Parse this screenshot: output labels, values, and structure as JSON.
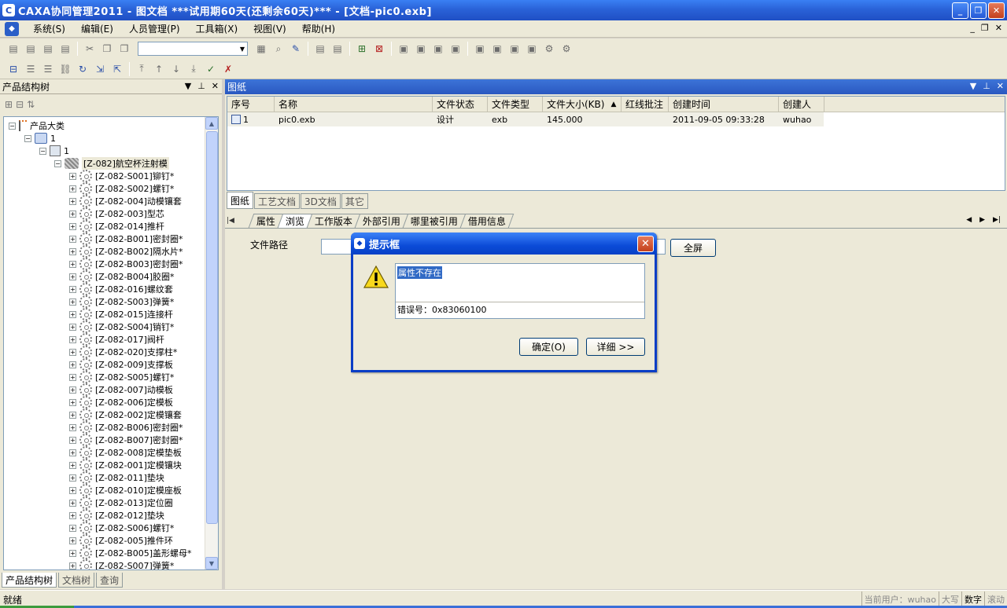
{
  "window": {
    "app_icon": "C",
    "title": "CAXA协同管理2011 - 图文档   ***试用期60天(还剩余60天)*** - [文档-pic0.exb]",
    "buttons": {
      "minimize": "_",
      "restore": "❐",
      "close": "✕"
    }
  },
  "menu": {
    "items": [
      "系统(S)",
      "编辑(E)",
      "人员管理(P)",
      "工具箱(X)",
      "视图(V)",
      "帮助(H)"
    ],
    "mdi_buttons": {
      "minimize": "_",
      "restore": "❐",
      "close": "✕"
    }
  },
  "left_panel": {
    "title": "产品结构树",
    "header_buttons": {
      "dropdown": "▼",
      "pin": "⊥",
      "close": "✕"
    },
    "tree": {
      "root": "产品大类",
      "level1": "1",
      "level2": "1",
      "assembly": "[Z-082]航空杯注射模",
      "parts": [
        "[Z-082-S001]铆钉*",
        "[Z-082-S002]螺钉*",
        "[Z-082-004]动模镶套",
        "[Z-082-003]型芯",
        "[Z-082-014]推杆",
        "[Z-082-B001]密封圈*",
        "[Z-082-B002]隔水片*",
        "[Z-082-B003]密封圈*",
        "[Z-082-B004]胶圈*",
        "[Z-082-016]螺纹套",
        "[Z-082-S003]弹簧*",
        "[Z-082-015]连接杆",
        "[Z-082-S004]销钉*",
        "[Z-082-017]阀杆",
        "[Z-082-020]支撑柱*",
        "[Z-082-009]支撑板",
        "[Z-082-S005]螺钉*",
        "[Z-082-007]动模板",
        "[Z-082-006]定模板",
        "[Z-082-002]定模镶套",
        "[Z-082-B006]密封圈*",
        "[Z-082-B007]密封圈*",
        "[Z-082-008]定模垫板",
        "[Z-082-001]定模镶块",
        "[Z-082-011]垫块",
        "[Z-082-010]定模座板",
        "[Z-082-013]定位圈",
        "[Z-082-012]垫块",
        "[Z-082-S006]螺钉*",
        "[Z-082-005]推件环",
        "[Z-082-B005]盖形螺母*",
        "[Z-082-S007]弹簧*"
      ]
    },
    "bottom_tabs": [
      "产品结构树",
      "文档树",
      "查询"
    ]
  },
  "drawing_panel": {
    "title": "图纸",
    "columns": [
      "序号",
      "名称",
      "文件状态",
      "文件类型",
      "文件大小(KB)",
      "红线批注",
      "创建时间",
      "创建人"
    ],
    "sort_indicator": "▲",
    "rows": [
      {
        "no": "1",
        "name": "pic0.exb",
        "status": "设计",
        "type": "exb",
        "size": "145.000",
        "redline": "",
        "created": "2011-09-05 09:33:28",
        "creator": "wuhao"
      }
    ],
    "doc_tabs": [
      "图纸",
      "工艺文档",
      "3D文档",
      "其它"
    ]
  },
  "property_tabs": [
    "属性",
    "浏览",
    "工作版本",
    "外部引用",
    "哪里被引用",
    "借用信息"
  ],
  "browse": {
    "file_path_label": "文件路径",
    "file_path_value": "",
    "fullscreen_button": "全屏"
  },
  "dialog": {
    "title": "提示框",
    "message": "属性不存在",
    "error_code": "错误号：0x83060100",
    "ok_button": "确定(O)",
    "detail_button": "详细 >>",
    "close": "✕"
  },
  "statusbar": {
    "ready": "就绪",
    "current_user": "当前用户：wuhao",
    "caps": "大写",
    "num": "数字",
    "scroll": "滚动"
  },
  "colors": {
    "title_bar": "#2a62d8",
    "dialog_border": "#0a3dc6",
    "selection": "#316ac5"
  }
}
